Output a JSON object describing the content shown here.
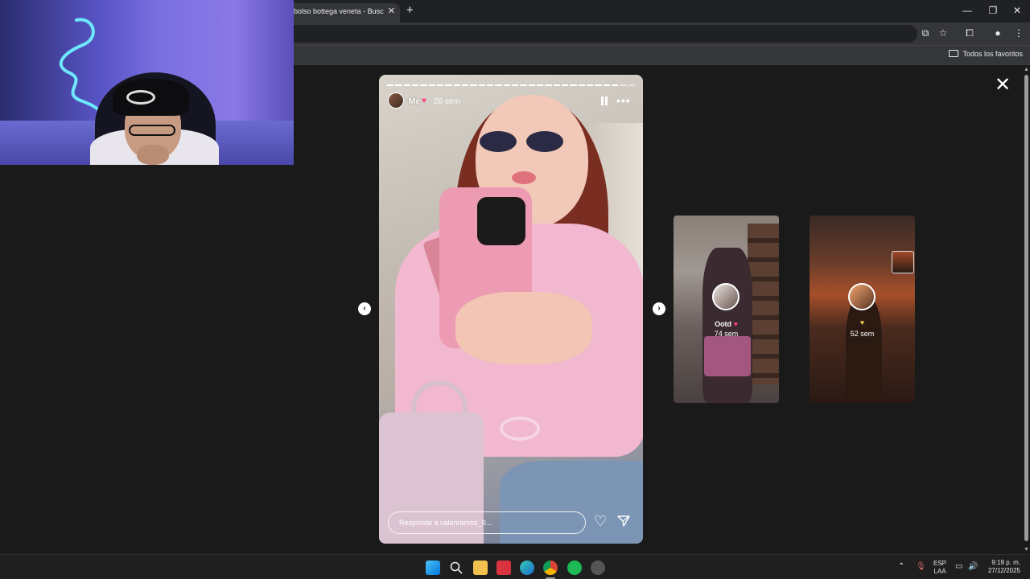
{
  "browser": {
    "tab_title": "bolso bottega veneta - Buscar",
    "tab_close": "✕",
    "new_tab": "+",
    "window": {
      "minimize": "—",
      "restore": "❐",
      "close": "✕"
    },
    "bookmarks": {
      "all_favorites": "Todos los favoritos"
    }
  },
  "story": {
    "username": "Me",
    "heart": "♥",
    "age": "26 sem",
    "more": "•••",
    "reply_placeholder": "Responde a valenramos_0...",
    "like": "♡",
    "segments": 30
  },
  "viewer": {
    "close": "✕",
    "prev": "‹",
    "next": "›"
  },
  "previews": [
    {
      "title": "Ootd",
      "heart": "♥",
      "age": "74 sem"
    },
    {
      "heart": "♥",
      "age": "52 sem"
    }
  ],
  "taskbar": {
    "language_line1": "ESP",
    "language_line2": "LAA",
    "time": "9:19 p. m.",
    "date": "27/12/2025"
  }
}
